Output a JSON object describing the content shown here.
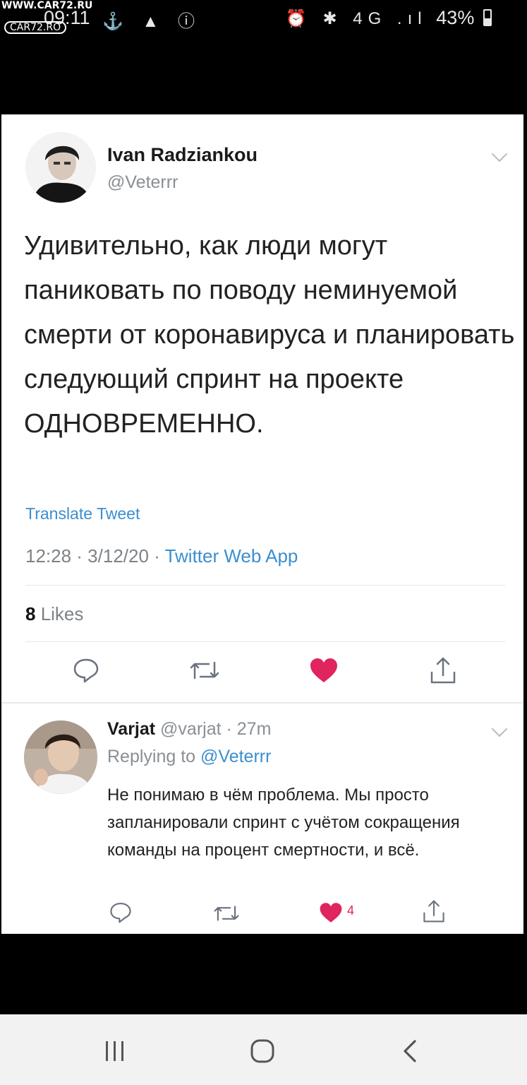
{
  "status_bar": {
    "time": "09:11",
    "left_icons": "⚓ ▲ ⓘ",
    "right_icons": "⏰ ✱ 4G .ıl",
    "battery": "43%"
  },
  "watermark": {
    "site": "WWW.CAR72.RU",
    "logo": "CAR72.RO"
  },
  "tweet": {
    "author_name": "Ivan Radziankou",
    "author_handle": "@Veterrr",
    "text": "Удивительно, как люди могут паниковать по поводу неминуемой смерти от коронавируса и планировать следующий спринт на проекте ОДНОВРЕМЕННО.",
    "translate": "Translate Tweet",
    "time": "12:28 · 3/12/20 · ",
    "source": "Twitter Web App",
    "likes_count": "8",
    "likes_label": " Likes"
  },
  "reply": {
    "author_name": "Varjat",
    "meta": " @varjat · 27m",
    "replying_prefix": "Replying to ",
    "replying_handle": "@Veterrr",
    "text": "Не понимаю в чём проблема. Мы просто запланировали спринт с учётом сокращения команды на процент смертности, и всё.",
    "like_count": "4"
  },
  "colors": {
    "link": "#3a8fd0",
    "like": "#e0245e",
    "muted": "#8a8f94"
  },
  "icons": [
    "comment-icon",
    "retweet-icon",
    "heart-icon",
    "share-icon",
    "recent-apps-icon",
    "home-icon",
    "back-icon"
  ]
}
